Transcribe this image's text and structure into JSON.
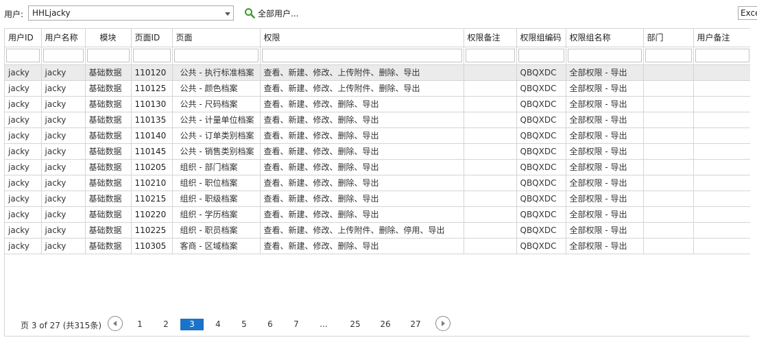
{
  "toolbar": {
    "user_label": "用户:",
    "user_value": "HHLjacky",
    "all_users_label": "全部用户...",
    "export_label": "Excel"
  },
  "columns": [
    "用户ID",
    "用户名称",
    "模块",
    "页面ID",
    "页面",
    "权限",
    "权限备注",
    "权限组编码",
    "权限组名称",
    "部门",
    "用户备注"
  ],
  "rows": [
    [
      "jacky",
      "jacky",
      "基础数据",
      "110120",
      "公共 - 执行标准档案",
      "查看、新建、修改、上传附件、删除、导出",
      "",
      "QBQXDC",
      "全部权限 - 导出",
      "",
      ""
    ],
    [
      "jacky",
      "jacky",
      "基础数据",
      "110125",
      "公共 - 颜色档案",
      "查看、新建、修改、上传附件、删除、导出",
      "",
      "QBQXDC",
      "全部权限 - 导出",
      "",
      ""
    ],
    [
      "jacky",
      "jacky",
      "基础数据",
      "110130",
      "公共 - 尺码档案",
      "查看、新建、修改、删除、导出",
      "",
      "QBQXDC",
      "全部权限 - 导出",
      "",
      ""
    ],
    [
      "jacky",
      "jacky",
      "基础数据",
      "110135",
      "公共 - 计量单位档案",
      "查看、新建、修改、删除、导出",
      "",
      "QBQXDC",
      "全部权限 - 导出",
      "",
      ""
    ],
    [
      "jacky",
      "jacky",
      "基础数据",
      "110140",
      "公共 - 订单类别档案",
      "查看、新建、修改、删除、导出",
      "",
      "QBQXDC",
      "全部权限 - 导出",
      "",
      ""
    ],
    [
      "jacky",
      "jacky",
      "基础数据",
      "110145",
      "公共 - 销售类别档案",
      "查看、新建、修改、删除、导出",
      "",
      "QBQXDC",
      "全部权限 - 导出",
      "",
      ""
    ],
    [
      "jacky",
      "jacky",
      "基础数据",
      "110205",
      "组织 - 部门档案",
      "查看、新建、修改、删除、导出",
      "",
      "QBQXDC",
      "全部权限 - 导出",
      "",
      ""
    ],
    [
      "jacky",
      "jacky",
      "基础数据",
      "110210",
      "组织 - 职位档案",
      "查看、新建、修改、删除、导出",
      "",
      "QBQXDC",
      "全部权限 - 导出",
      "",
      ""
    ],
    [
      "jacky",
      "jacky",
      "基础数据",
      "110215",
      "组织 - 职级档案",
      "查看、新建、修改、删除、导出",
      "",
      "QBQXDC",
      "全部权限 - 导出",
      "",
      ""
    ],
    [
      "jacky",
      "jacky",
      "基础数据",
      "110220",
      "组织 - 学历档案",
      "查看、新建、修改、删除、导出",
      "",
      "QBQXDC",
      "全部权限 - 导出",
      "",
      ""
    ],
    [
      "jacky",
      "jacky",
      "基础数据",
      "110225",
      "组织 - 职员档案",
      "查看、新建、修改、上传附件、删除、停用、导出",
      "",
      "QBQXDC",
      "全部权限 - 导出",
      "",
      ""
    ],
    [
      "jacky",
      "jacky",
      "基础数据",
      "110305",
      "客商 - 区域档案",
      "查看、新建、修改、删除、导出",
      "",
      "QBQXDC",
      "全部权限 - 导出",
      "",
      ""
    ]
  ],
  "pager": {
    "info": "页 3 of 27 (共315条)",
    "pages": [
      "1",
      "2",
      "3",
      "4",
      "5",
      "6",
      "7",
      "...",
      "25",
      "26",
      "27"
    ],
    "current": "3"
  },
  "colors": {
    "accent": "#1a73c8",
    "selected_row": "#ebebeb",
    "grid_line": "#d4d4d4"
  }
}
